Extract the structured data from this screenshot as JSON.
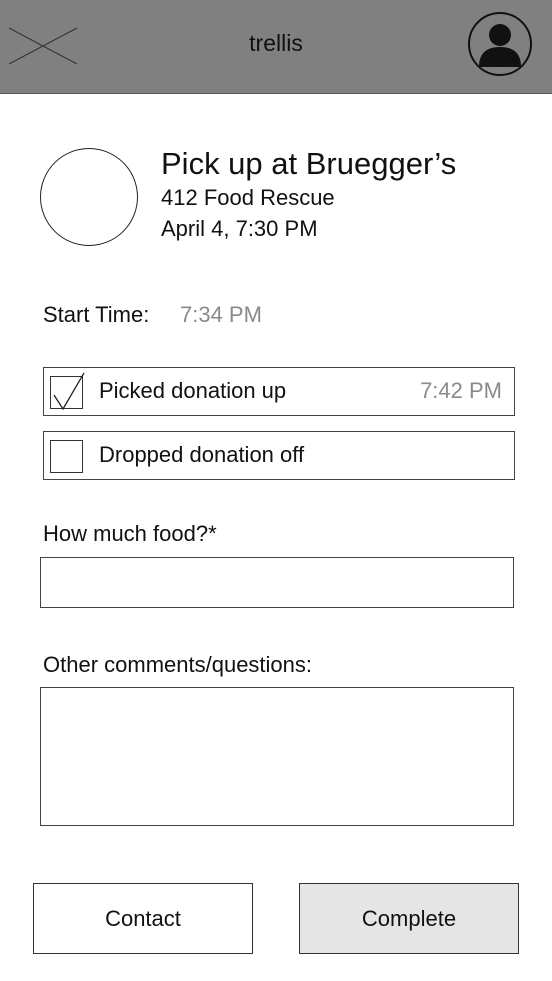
{
  "header": {
    "title": "trellis",
    "menu_icon": "x-cross-icon",
    "profile_icon": "user-avatar-icon",
    "background": "#808080"
  },
  "pickup": {
    "title": "Pick up at Bruegger’s",
    "organization": "412 Food Rescue",
    "datetime": "April 4, 7:30 PM"
  },
  "start_time": {
    "label": "Start Time:",
    "value": "7:34 PM"
  },
  "tasks": [
    {
      "label": "Picked donation up",
      "checked": true,
      "time": "7:42 PM"
    },
    {
      "label": "Dropped donation off",
      "checked": false,
      "time": ""
    }
  ],
  "form": {
    "food_label": "How much food?*",
    "food_value": "",
    "comments_label": "Other comments/questions:",
    "comments_value": ""
  },
  "buttons": {
    "contact": "Contact",
    "complete": "Complete",
    "complete_background": "#e5e5e5"
  }
}
